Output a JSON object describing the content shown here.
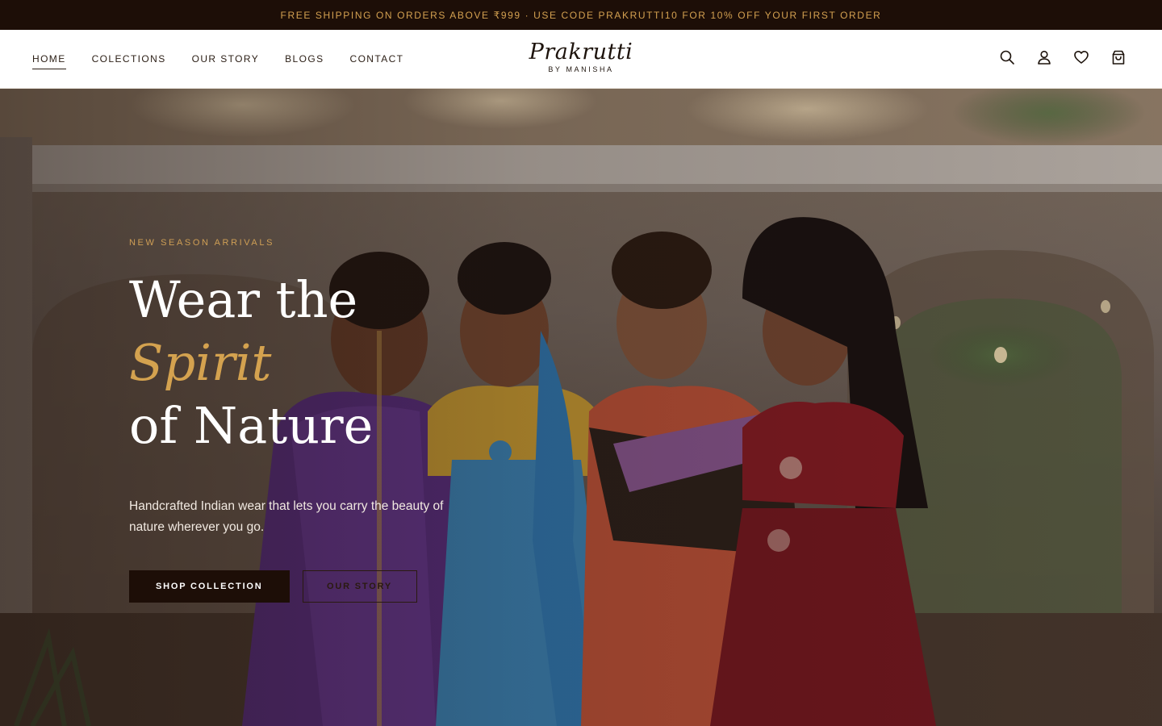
{
  "announcement": {
    "text": "FREE SHIPPING ON ORDERS ABOVE ₹999 · USE CODE PRAKRUTTI10 FOR 10% OFF YOUR FIRST ORDER"
  },
  "header": {
    "nav": [
      {
        "label": "HOME",
        "active": true
      },
      {
        "label": "COLECTIONS",
        "active": false
      },
      {
        "label": "OUR STORY",
        "active": false
      },
      {
        "label": "BLOGS",
        "active": false
      },
      {
        "label": "CONTACT",
        "active": false
      }
    ],
    "logo": {
      "name": "Prakrutti",
      "tagline": "BY MANISHA"
    },
    "icons": [
      "search-icon",
      "account-icon",
      "wishlist-heart-icon",
      "cart-bag-icon"
    ]
  },
  "hero": {
    "eyebrow": "NEW SEASON ARRIVALS",
    "headline_line1": "Wear the",
    "headline_accent": "Spirit",
    "headline_line3": "of Nature",
    "description": "Handcrafted Indian wear that lets you carry the beauty of nature wherever you go.",
    "primary_cta": "SHOP COLLECTION",
    "secondary_cta": "OUR STORY"
  },
  "colors": {
    "announcement_bg": "#1d0e07",
    "announcement_text": "#d3a050",
    "accent_gold": "#d4a24f",
    "primary_button": "#1d0e07"
  }
}
